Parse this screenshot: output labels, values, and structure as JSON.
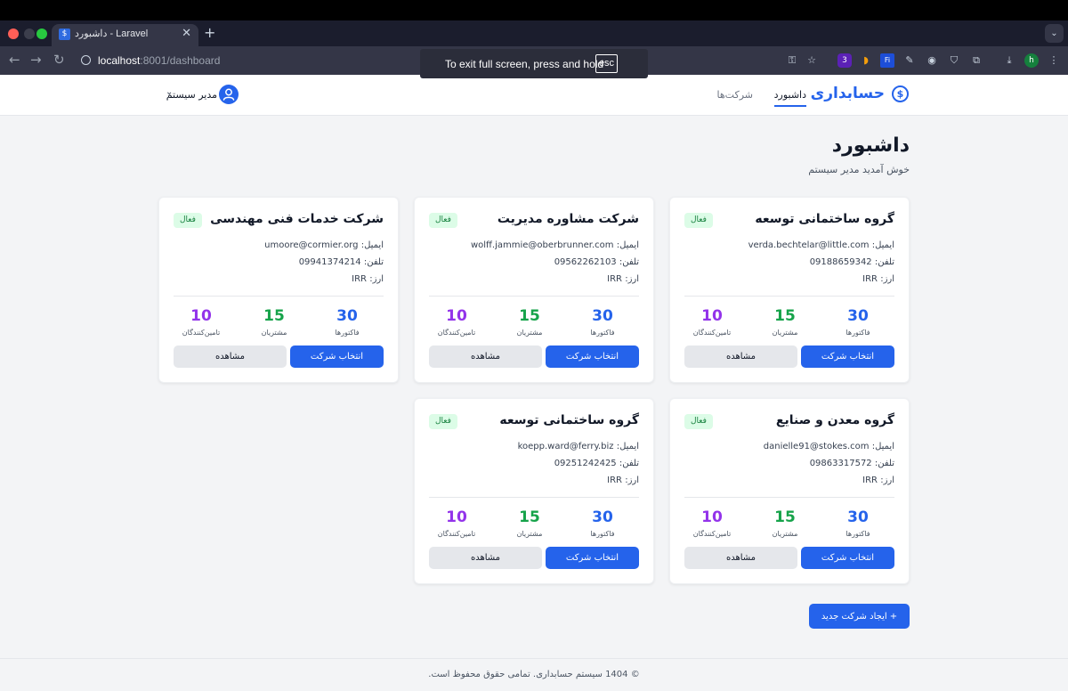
{
  "browser": {
    "tab_title": "داشبورد - Laravel",
    "tab_favicon": "$",
    "url_host": "localhost",
    "url_path": ":8001/dashboard",
    "toast_text": "To exit full screen, press and hold",
    "toast_key": "esc",
    "ext_badge": "3",
    "profile_letter": "h"
  },
  "header": {
    "brand_name": "حسابداری",
    "brand_icon": "$",
    "nav": [
      {
        "label": "داشبورد",
        "active": true
      },
      {
        "label": "شرکت‌ها",
        "active": false
      }
    ],
    "user_name": "مدیر سیستم"
  },
  "page": {
    "title": "داشبورد",
    "subtitle": "خوش آمدید مدیر سیستم"
  },
  "companies": [
    {
      "name": "گروه ساختمانی توسعه",
      "status": "فعال",
      "email": "ایمیل: verda.bechtelar@little.com",
      "phone": "تلفن: 09188659342",
      "currency": "ارز: IRR",
      "invoices": "30",
      "customers": "15",
      "suppliers": "10"
    },
    {
      "name": "شرکت مشاوره مدیریت",
      "status": "فعال",
      "email": "ایمیل: wolff.jammie@oberbrunner.com",
      "phone": "تلفن: 09562262103",
      "currency": "ارز: IRR",
      "invoices": "30",
      "customers": "15",
      "suppliers": "10"
    },
    {
      "name": "شرکت خدمات فنی مهندسی",
      "status": "فعال",
      "email": "ایمیل: umoore@cormier.org",
      "phone": "تلفن: 09941374214",
      "currency": "ارز: IRR",
      "invoices": "30",
      "customers": "15",
      "suppliers": "10"
    },
    {
      "name": "گروه معدن و صنایع",
      "status": "فعال",
      "email": "ایمیل: danielle91@stokes.com",
      "phone": "تلفن: 09863317572",
      "currency": "ارز: IRR",
      "invoices": "30",
      "customers": "15",
      "suppliers": "10"
    },
    {
      "name": "گروه ساختمانی توسعه",
      "status": "فعال",
      "email": "ایمیل: koepp.ward@ferry.biz",
      "phone": "تلفن: 09251242425",
      "currency": "ارز: IRR",
      "invoices": "30",
      "customers": "15",
      "suppliers": "10"
    }
  ],
  "labels": {
    "invoices": "فاکتورها",
    "customers": "مشتریان",
    "suppliers": "تامین‌کنندگان",
    "select_button": "انتخاب شرکت",
    "view_button": "مشاهده"
  },
  "create_button": "+ ایجاد شرکت جدید",
  "footer": "© 1404 سیستم حسابداری. تمامی حقوق محفوظ است.",
  "colors": {
    "accent": "#2563eb",
    "invoices": "#2563eb",
    "customers": "#16a34a",
    "suppliers": "#9333ea",
    "badge_bg": "#dcfce7",
    "badge_text": "#15803d"
  }
}
